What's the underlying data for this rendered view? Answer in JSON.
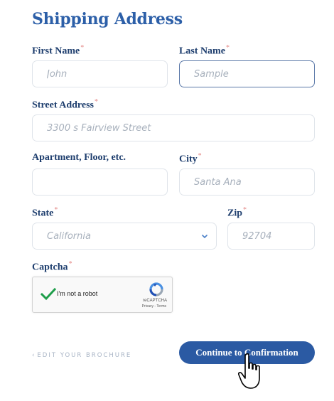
{
  "form": {
    "title": "Shipping Address",
    "required_mark": "*",
    "first_name": {
      "label": "First Name",
      "placeholder": "John",
      "value": ""
    },
    "last_name": {
      "label": "Last Name",
      "placeholder": "Sample",
      "value": ""
    },
    "street": {
      "label": "Street Address",
      "placeholder": "3300 s Fairview Street",
      "value": ""
    },
    "apartment": {
      "label": "Apartment, Floor, etc.",
      "placeholder": "",
      "value": ""
    },
    "city": {
      "label": "City",
      "placeholder": "Santa Ana",
      "value": ""
    },
    "state": {
      "label": "State",
      "selected": "California",
      "chevron_icon": "chevron-down-icon"
    },
    "zip": {
      "label": "Zip",
      "placeholder": "92704",
      "value": ""
    },
    "captcha": {
      "label": "Captcha",
      "checkbox_text": "I'm not a robot",
      "brand": "reCAPTCHA",
      "terms": "Privacy - Terms"
    }
  },
  "footer": {
    "back_label": "EDIT YOUR BROCHURE",
    "continue_label": "Continue to Confirmation"
  },
  "colors": {
    "heading": "#2c5fa8",
    "label": "#1e3e6e",
    "required": "#e48a88",
    "button": "#2b5aa3",
    "check": "#1e9e4a"
  }
}
